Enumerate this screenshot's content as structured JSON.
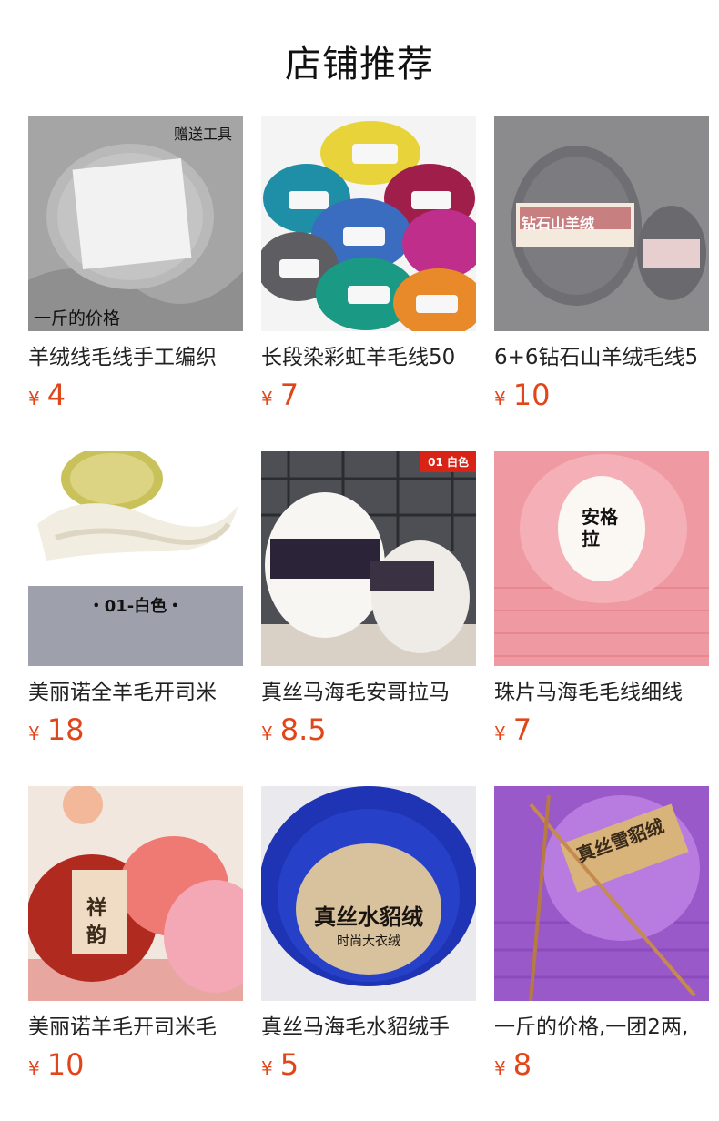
{
  "header": {
    "title": "店铺推荐"
  },
  "products": [
    {
      "name": "羊绒线毛线手工编织",
      "currency": "¥",
      "price": "4",
      "overlay_top": "赠送工具",
      "overlay_bottom": "一斤的价格"
    },
    {
      "name": "长段染彩虹羊毛线50",
      "currency": "¥",
      "price": "7"
    },
    {
      "name": "6+6钻石山羊绒毛线5",
      "currency": "¥",
      "price": "10",
      "label": "钻石山羊绒"
    },
    {
      "name": "美丽诺全羊毛开司米",
      "currency": "¥",
      "price": "18",
      "band_text": "・01-白色・"
    },
    {
      "name": "真丝马海毛安哥拉马",
      "currency": "¥",
      "price": "8.5",
      "ribbon": "01 白色"
    },
    {
      "name": "珠片马海毛毛线细线",
      "currency": "¥",
      "price": "7",
      "label": "安格拉"
    },
    {
      "name": "美丽诺羊毛开司米毛",
      "currency": "¥",
      "price": "10",
      "label": "祥韵"
    },
    {
      "name": "真丝马海毛水貂绒手",
      "currency": "¥",
      "price": "5",
      "label": "真丝水貂绒",
      "sublabel": "时尚大衣绒"
    },
    {
      "name": "一斤的价格,一团2两,",
      "currency": "¥",
      "price": "8",
      "label": "真丝雪貂绒"
    }
  ]
}
